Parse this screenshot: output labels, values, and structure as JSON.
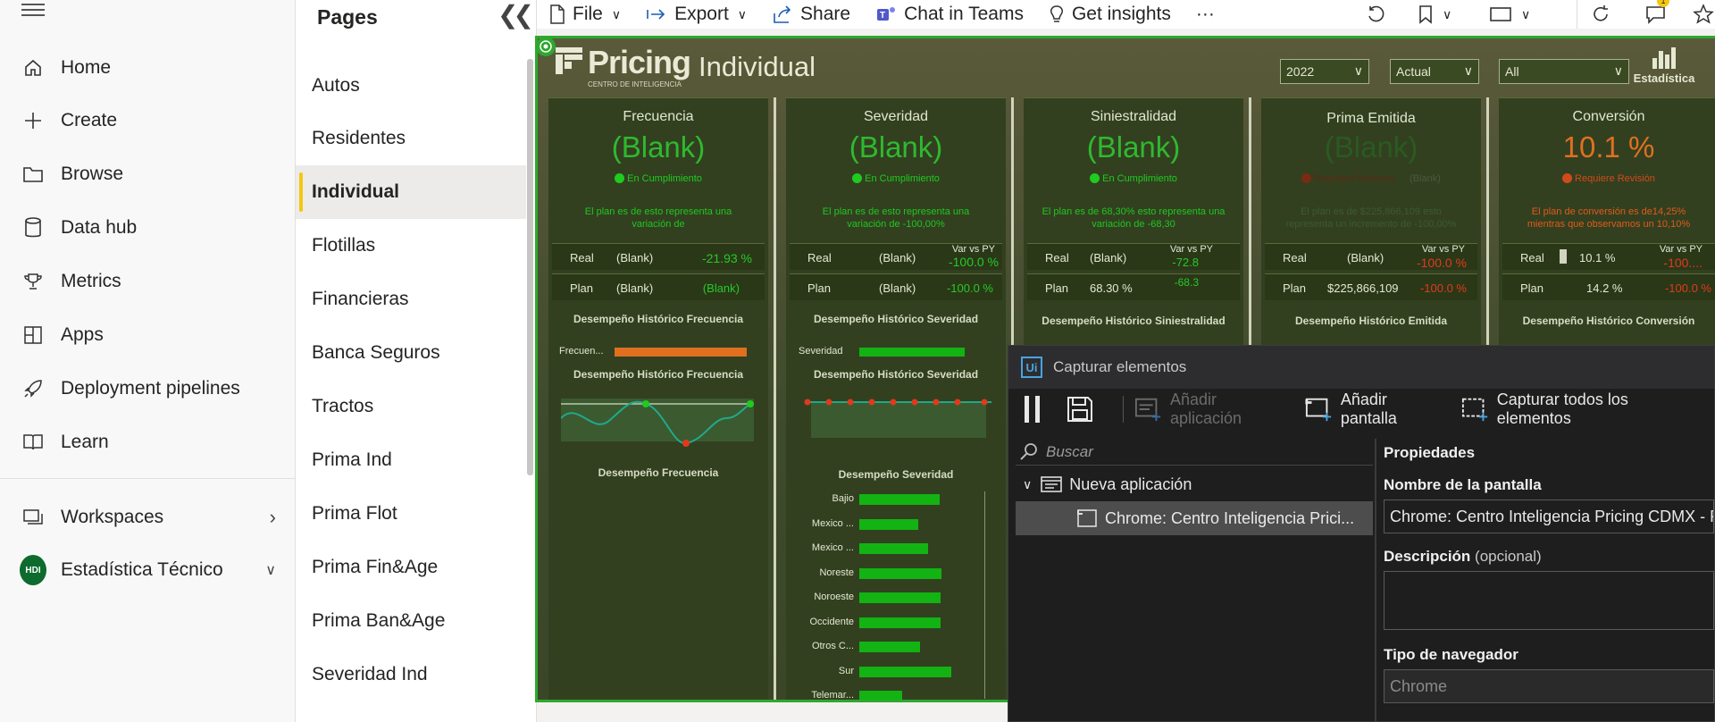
{
  "nav": {
    "items": [
      {
        "label": "Home",
        "icon": "home-icon"
      },
      {
        "label": "Create",
        "icon": "plus-icon"
      },
      {
        "label": "Browse",
        "icon": "folder-icon"
      },
      {
        "label": "Data hub",
        "icon": "database-icon"
      },
      {
        "label": "Metrics",
        "icon": "trophy-icon"
      },
      {
        "label": "Apps",
        "icon": "apps-icon"
      },
      {
        "label": "Deployment pipelines",
        "icon": "rocket-icon"
      },
      {
        "label": "Learn",
        "icon": "book-icon"
      }
    ],
    "workspaces": "Workspaces",
    "workspace_current": "Estadística Técnico",
    "workspace_badge": "HDI"
  },
  "pages": {
    "title": "Pages",
    "items": [
      "Autos",
      "Residentes",
      "Individual",
      "Flotillas",
      "Financieras",
      "Banca Seguros",
      "Tractos",
      "Prima Ind",
      "Prima Flot",
      "Prima Fin&Age",
      "Prima Ban&Age",
      "Severidad Ind"
    ],
    "active": "Individual"
  },
  "toolbar": {
    "file": "File",
    "export": "Export",
    "share": "Share",
    "chat": "Chat in Teams",
    "insights": "Get insights",
    "more": "···",
    "notif_count": "1"
  },
  "report": {
    "logo": "Pricing",
    "logo_sub": "CENTRO DE INTELIGENCIA",
    "title": "Individual",
    "slicers": {
      "year": "2022",
      "scenario": "Actual",
      "filter": "All"
    },
    "estadistica": "Estadística",
    "colors": {
      "green": "#1fcb1f",
      "red": "#e03a1a",
      "orange": "#e0701f"
    },
    "cards": {
      "frecuencia": {
        "title": "Frecuencia",
        "value": "(Blank)",
        "status": "En Cumplimiento",
        "note": "El plan es de  esto representa una variación de",
        "real_lbl": "Real",
        "real_val": "(Blank)",
        "real_vs": "-21.93 %",
        "plan_lbl": "Plan",
        "plan_val": "(Blank)",
        "plan_vs": "(Blank)",
        "hist1": "Desempeño Histórico Frecuencia",
        "bar_lbl": "Frecuen...",
        "hist2": "Desempeño Histórico Frecuencia",
        "perf": "Desempeño Frecuencia"
      },
      "severidad": {
        "title": "Severidad",
        "value": "(Blank)",
        "status": "En Cumplimiento",
        "note": "El plan es de  esto representa una variación de -100,00%",
        "vs_hdr": "Var vs PY",
        "real_lbl": "Real",
        "real_val": "(Blank)",
        "real_vs": "-100.0 %",
        "plan_lbl": "Plan",
        "plan_val": "(Blank)",
        "plan_vs": "-100.0 %",
        "hist1": "Desempeño Histórico Severidad",
        "bar_lbl": "Severidad",
        "hist2": "Desempeño Histórico Severidad",
        "perf": "Desempeño Severidad",
        "regions": [
          {
            "name": "Bajio",
            "value": 82
          },
          {
            "name": "Mexico ...",
            "value": 60
          },
          {
            "name": "Mexico ...",
            "value": 70
          },
          {
            "name": "Noreste",
            "value": 84
          },
          {
            "name": "Noroeste",
            "value": 83
          },
          {
            "name": "Occidente",
            "value": 83
          },
          {
            "name": "Otros C...",
            "value": 62
          },
          {
            "name": "Sur",
            "value": 94
          },
          {
            "name": "Telemar...",
            "value": 44
          }
        ]
      },
      "siniestralidad": {
        "title": "Siniestralidad",
        "value": "(Blank)",
        "status": "En Cumplimiento",
        "note": "El plan es de 68,30% esto representa una variación de -68,30",
        "vs_hdr": "Var vs PY",
        "real_lbl": "Real",
        "real_val": "(Blank)",
        "real_vs": "-72.8",
        "plan_lbl": "Plan",
        "plan_val": "68.30 %",
        "plan_vs": "-68.3",
        "hist1": "Desempeño Histórico Siniestralidad"
      },
      "prima": {
        "title": "Prima Emitida",
        "value": "(Blank)",
        "status": "Requiere Revisión",
        "status_extra": "(Blank)",
        "note": "El plan es de $225,866,109 esto representa un incremento de -100,00%",
        "vs_hdr": "Var vs PY",
        "real_lbl": "Real",
        "real_val": "(Blank)",
        "real_vs": "-100.0 %",
        "plan_lbl": "Plan",
        "plan_val": "$225,866,109",
        "plan_vs": "-100.0 %",
        "hist1": "Desempeño Histórico Emitida"
      },
      "conversion": {
        "title": "Conversión",
        "value": "10.1 %",
        "status": "Requiere Revisión",
        "note": "El plan de conversión es de14,25% mientras que observamos un 10,10%",
        "vs_hdr": "Var vs PY",
        "real_lbl": "Real",
        "real_val": "10.1 %",
        "real_vs": "-100....",
        "plan_lbl": "Plan",
        "plan_val": "14.2 %",
        "plan_vs": "-100.0 %",
        "hist1": "Desempeño Histórico Conversión"
      }
    }
  },
  "capture": {
    "title": "Capturar elementos",
    "add_app": "Añadir aplicación",
    "add_screen": "Añadir pantalla",
    "capture_all": "Capturar todos los elementos",
    "search_placeholder": "Buscar",
    "tree_root": "Nueva aplicación",
    "tree_child": "Chrome: Centro Inteligencia Prici...",
    "props_title": "Propiedades",
    "screen_name_lbl": "Nombre de la pantalla",
    "screen_name_val": "Chrome: Centro Inteligencia Pricing CDMX - P",
    "desc_lbl": "Descripción",
    "desc_opt": "(opcional)",
    "browser_lbl": "Tipo de navegador",
    "browser_val": "Chrome"
  }
}
